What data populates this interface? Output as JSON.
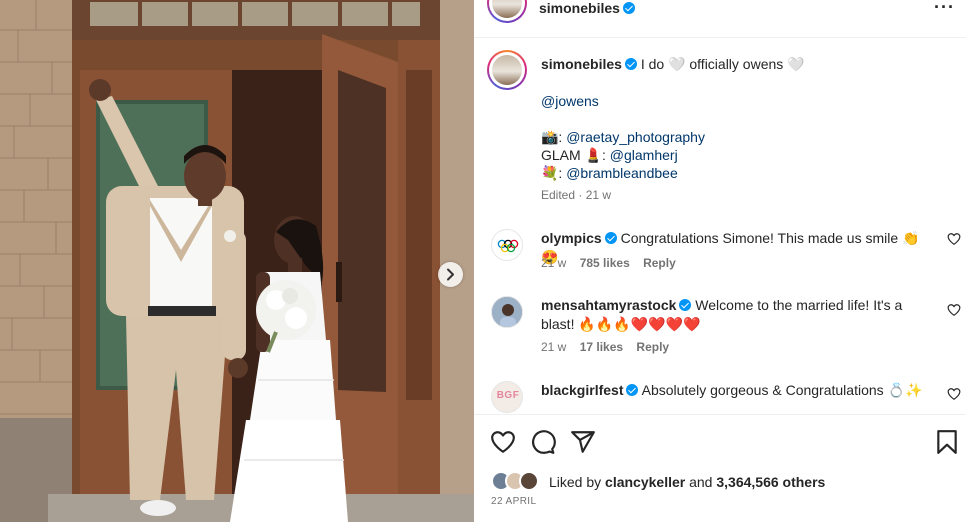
{
  "post": {
    "username": "simonebiles",
    "more_icon": "more-horizontal-icon"
  },
  "caption": {
    "username": "simonebiles",
    "text": "I do 🤍 officially owens 🤍",
    "mention": "@jowens",
    "photo_prefix": "📸:",
    "photo_handle": "@raetay_photography",
    "glam_prefix": "GLAM 💄:",
    "glam_handle": "@glamherj",
    "flowers_prefix": "💐:",
    "flowers_handle": "@brambleandbee",
    "meta": "Edited · 21 w"
  },
  "comments": [
    {
      "username": "olympics",
      "text": "Congratulations Simone! This made us smile 👏😍",
      "time": "21 w",
      "likes": "785 likes",
      "reply": "Reply"
    },
    {
      "username": "mensahtamyrastock",
      "text": "Welcome to the married life! It's a blast! 🔥🔥🔥❤️❤️❤️❤️",
      "time": "21 w",
      "likes": "17 likes",
      "reply": "Reply"
    },
    {
      "username": "blackgirlfest",
      "text": "Absolutely gorgeous & Congratulations 💍✨",
      "avatar_text": "BGF"
    }
  ],
  "actions": {
    "like_icon": "heart-icon",
    "comment_icon": "comment-icon",
    "share_icon": "share-icon",
    "save_icon": "bookmark-icon"
  },
  "likes": {
    "prefix": "Liked by",
    "liker": "clancykeller",
    "joiner": "and",
    "count": "3,364,566 others"
  },
  "date": "22 APRIL",
  "colors": {
    "verified": "#0095f6",
    "link": "#00376b",
    "muted": "#737373"
  }
}
